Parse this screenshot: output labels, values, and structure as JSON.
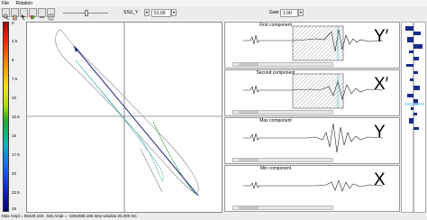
{
  "menu": {
    "file": "File",
    "rotation": "Rotation"
  },
  "toolbar": {
    "component_value": "SSU_Y",
    "angle_value": "51.00",
    "gain_label": "Gain",
    "gain_value": "1.00"
  },
  "colorbar": {
    "ticks": [
      "0",
      "2.5",
      "5",
      "7.5",
      "10",
      "12.5",
      "15",
      "17.5",
      "20",
      "22.5",
      "25"
    ]
  },
  "components": [
    {
      "title": "First component",
      "label": "Y′"
    },
    {
      "title": "Second component",
      "label": "X′"
    },
    {
      "title": "Max component",
      "label": "Y"
    },
    {
      "title": "Min component",
      "label": "X"
    }
  ],
  "status": {
    "text": "Max Ampl = 86429.193 , Min Ampl = -1001668.186   time window   25.000 ms"
  }
}
